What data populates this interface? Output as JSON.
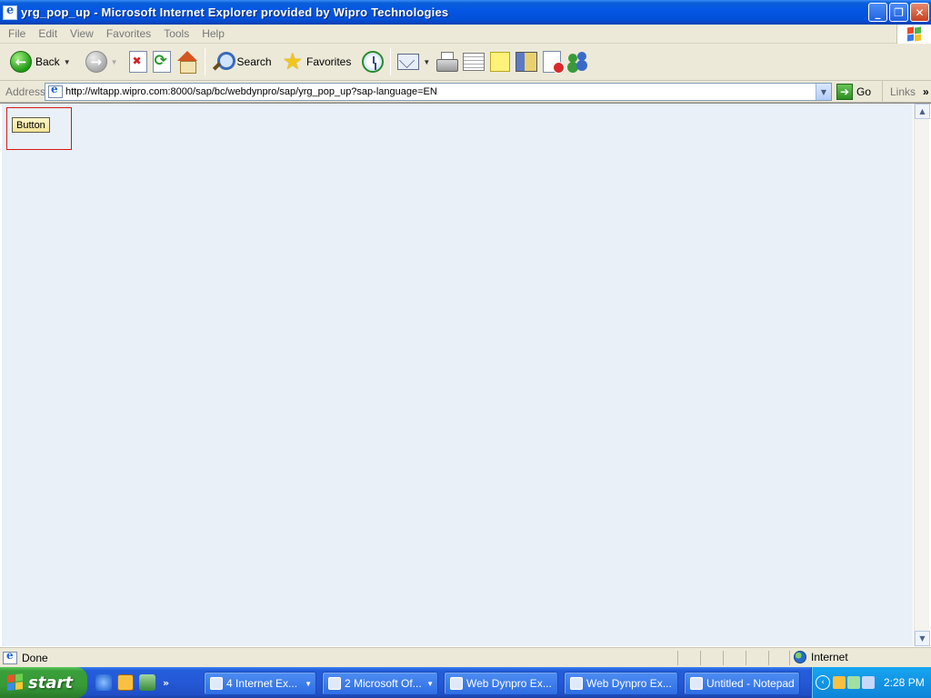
{
  "window": {
    "title": "yrg_pop_up - Microsoft Internet Explorer provided by Wipro Technologies",
    "controls": {
      "minimize": "_",
      "maximize": "❐",
      "close": "✕"
    }
  },
  "menu": {
    "items": [
      "File",
      "Edit",
      "View",
      "Favorites",
      "Tools",
      "Help"
    ]
  },
  "toolbar": {
    "back_label": "Back",
    "search_label": "Search",
    "favorites_label": "Favorites"
  },
  "address": {
    "label": "Address",
    "url": "http://wltapp.wipro.com:8000/sap/bc/webdynpro/sap/yrg_pop_up?sap-language=EN",
    "go_label": "Go",
    "links_label": "Links"
  },
  "page": {
    "button_label": "Button",
    "container_border_color": "#d61818",
    "background_color": "#e9f0f7"
  },
  "status": {
    "text": "Done",
    "zone": "Internet"
  },
  "taskbar": {
    "start_label": "start",
    "tasks": [
      {
        "label": "4 Internet Ex..."
      },
      {
        "label": "2 Microsoft Of..."
      },
      {
        "label": "Web Dynpro Ex..."
      },
      {
        "label": "Web Dynpro Ex..."
      },
      {
        "label": "Untitled - Notepad"
      }
    ],
    "clock": "2:28 PM"
  }
}
